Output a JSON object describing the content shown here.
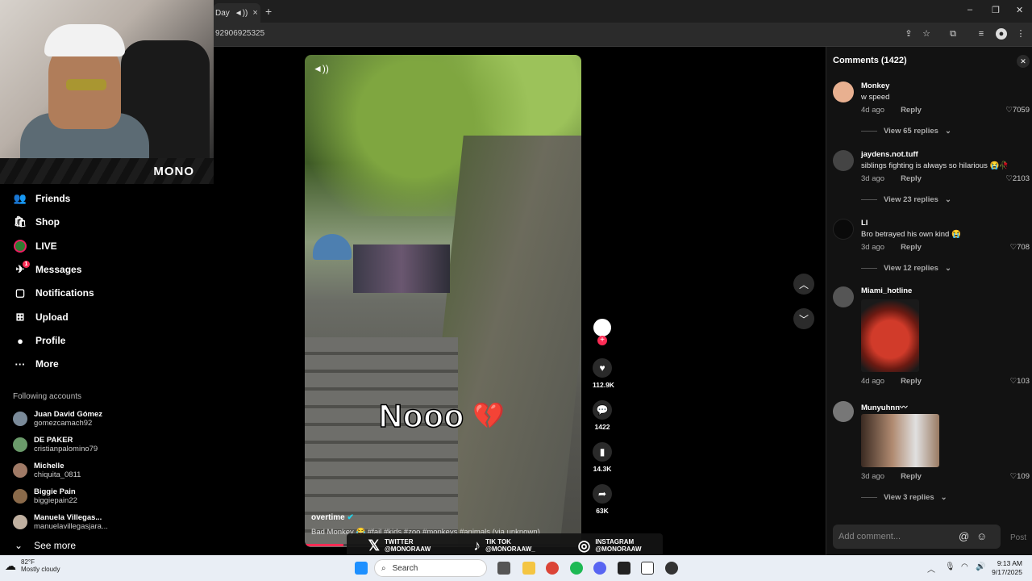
{
  "browser": {
    "tab_title": "Day",
    "url_fragment": "92906925325",
    "new_tab": "+",
    "close_tab": "×",
    "window_controls": [
      "–",
      "❐",
      "✕"
    ]
  },
  "stream": {
    "brand": "MONO"
  },
  "sidebar": {
    "items": [
      {
        "label": "Friends",
        "icon": "friends-icon",
        "glyph": "👥"
      },
      {
        "label": "Shop",
        "icon": "shop-icon",
        "glyph": "🛍"
      },
      {
        "label": "LIVE",
        "icon": "live-icon",
        "glyph": ""
      },
      {
        "label": "Messages",
        "icon": "messages-icon",
        "glyph": "✈"
      },
      {
        "label": "Notifications",
        "icon": "notifications-icon",
        "glyph": "▢"
      },
      {
        "label": "Upload",
        "icon": "upload-icon",
        "glyph": "⊞"
      },
      {
        "label": "Profile",
        "icon": "profile-icon",
        "glyph": "●"
      },
      {
        "label": "More",
        "icon": "more-icon",
        "glyph": "···"
      }
    ],
    "messages_badge": "1",
    "following_title": "Following accounts",
    "accounts": [
      {
        "name": "Juan David Gómez",
        "handle": "gomezcamach92",
        "color": "#7a8a99"
      },
      {
        "name": "DE PAKER",
        "handle": "cristianpalomino79",
        "color": "#6a9a6a"
      },
      {
        "name": "Michelle",
        "handle": "chiquita_0811",
        "color": "#a07a66"
      },
      {
        "name": "Biggie Pain",
        "handle": "biggiepain22",
        "color": "#8a6a4a"
      },
      {
        "name": "Manuela Villegas...",
        "handle": "manuelavillegasjara...",
        "color": "#c0b0a0"
      }
    ],
    "see_more": "See more"
  },
  "video": {
    "overlay_text": "Nooo",
    "author": "overtime",
    "description": "Bad Monkey 😂 #fail #kids #zoo #monkeys #animals (via unknown)",
    "progress": 0.14
  },
  "actions": {
    "likes": "112.9K",
    "comments": "1422",
    "saves": "14.3K",
    "shares": "63K"
  },
  "comments_panel": {
    "title": "Comments (1422)",
    "reply_label": "Reply",
    "comments": [
      {
        "user": "Monkey",
        "text": "w speed",
        "age": "4d ago",
        "likes": "7059",
        "replies": "View 65 replies",
        "color": "#e8b090"
      },
      {
        "user": "jaydens.not.tuff",
        "text": "siblings fighting is always so hilarious 😭🥀",
        "age": "3d ago",
        "likes": "2103",
        "replies": "View 23 replies",
        "color": "#444"
      },
      {
        "user": "Ll",
        "text": "Bro betrayed his own kind 😭",
        "age": "3d ago",
        "likes": "708",
        "replies": "View 12 replies",
        "color": "#0a0a0a"
      },
      {
        "user": "Miami_hotline",
        "text": "",
        "age": "4d ago",
        "likes": "103",
        "replies": "",
        "color": "#555"
      },
      {
        "user": "Munyuhnn〰",
        "text": "",
        "age": "3d ago",
        "likes": "109",
        "replies": "View 3 replies",
        "color": "#777"
      }
    ],
    "add_placeholder": "Add comment...",
    "post_label": "Post"
  },
  "socials": [
    {
      "logo": "𝕏",
      "line1": "TWITTER",
      "line2": "@MONORAAW"
    },
    {
      "logo": "♪",
      "line1": "TIK TOK",
      "line2": "@MONORAAW_"
    },
    {
      "logo": "◎",
      "line1": "INSTAGRAM",
      "line2": "@MONORAAW"
    }
  ],
  "taskbar": {
    "temperature": "82°F",
    "weather": "Mostly cloudy",
    "search_placeholder": "Search",
    "time": "9:13 AM",
    "date": "9/17/2025"
  }
}
